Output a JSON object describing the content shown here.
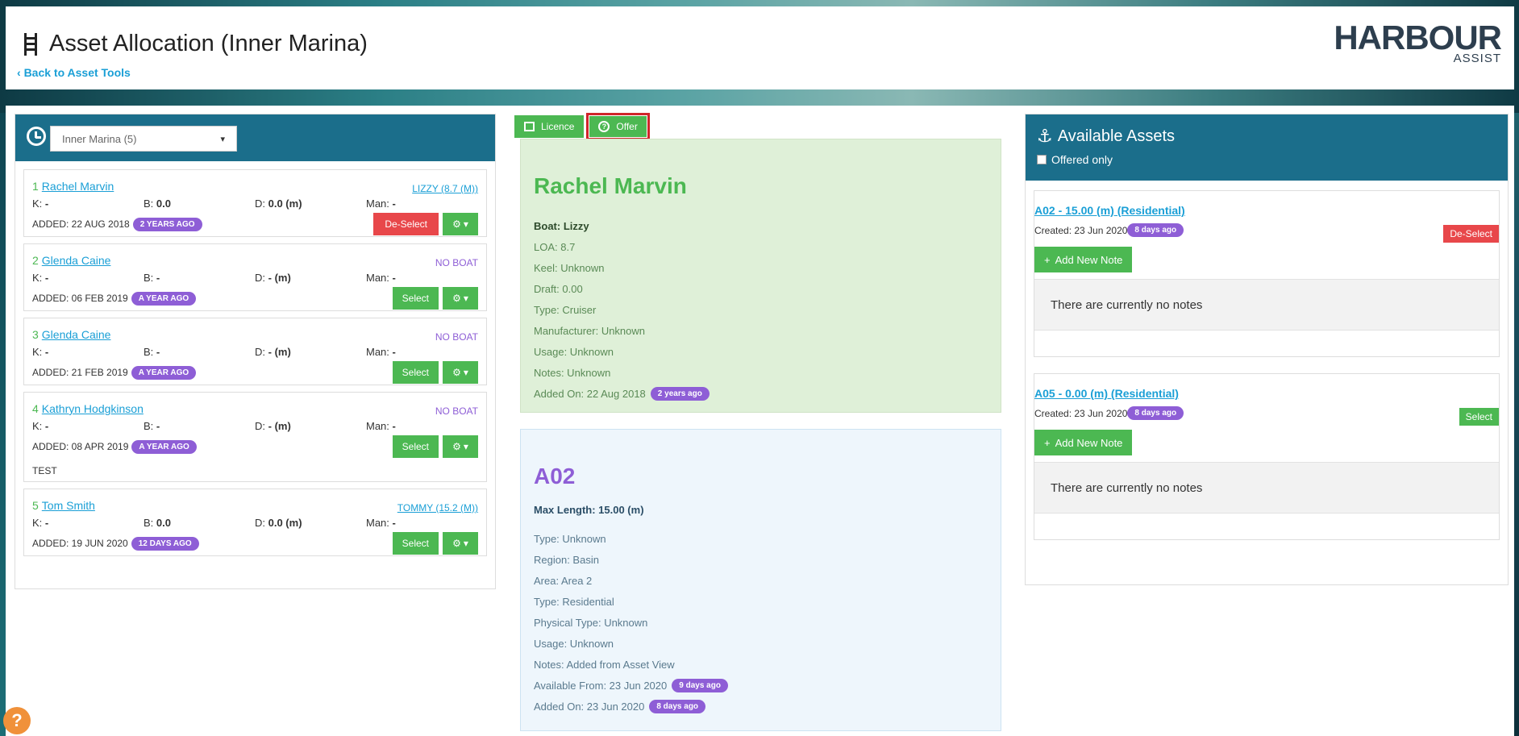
{
  "header": {
    "title": "Asset Allocation (Inner Marina)",
    "back_link": "Back to Asset Tools",
    "logo_main": "HARBOUR",
    "logo_sub": "ASSIST"
  },
  "left": {
    "select_value": "Inner Marina (5)",
    "customers": [
      {
        "num": "1",
        "name": "Rachel Marvin",
        "boat": "LIZZY (8.7 (M))",
        "boat_type": "link",
        "k": "-",
        "b": "0.0",
        "d": "0.0 (m)",
        "man": "-",
        "added": "ADDED: 22 AUG 2018",
        "age": "2 YEARS AGO",
        "action": "De-Select",
        "action_type": "red",
        "note": ""
      },
      {
        "num": "2",
        "name": "Glenda Caine",
        "boat": "NO BOAT",
        "boat_type": "noboat",
        "k": "-",
        "b": "-",
        "d": "- (m)",
        "man": "-",
        "added": "ADDED: 06 FEB 2019",
        "age": "A YEAR AGO",
        "action": "Select",
        "action_type": "green",
        "note": ""
      },
      {
        "num": "3",
        "name": "Glenda Caine",
        "boat": "NO BOAT",
        "boat_type": "noboat",
        "k": "-",
        "b": "-",
        "d": "- (m)",
        "man": "-",
        "added": "ADDED: 21 FEB 2019",
        "age": "A YEAR AGO",
        "action": "Select",
        "action_type": "green",
        "note": ""
      },
      {
        "num": "4",
        "name": "Kathryn Hodgkinson",
        "boat": "NO BOAT",
        "boat_type": "noboat",
        "k": "-",
        "b": "-",
        "d": "- (m)",
        "man": "-",
        "added": "ADDED: 08 APR 2019",
        "age": "A YEAR AGO",
        "action": "Select",
        "action_type": "green",
        "note": "TEST"
      },
      {
        "num": "5",
        "name": "Tom Smith",
        "boat": "TOMMY (15.2 (M))",
        "boat_type": "link",
        "k": "-",
        "b": "0.0",
        "d": "0.0 (m)",
        "man": "-",
        "added": "ADDED: 19 JUN 2020",
        "age": "12 DAYS AGO",
        "action": "Select",
        "action_type": "green",
        "note": ""
      }
    ],
    "labels": {
      "k": "K:",
      "b": "B:",
      "d": "D:",
      "man": "Man:"
    }
  },
  "tabs": {
    "licence": "Licence",
    "offer": "Offer"
  },
  "person": {
    "name": "Rachel Marvin",
    "boat": "Boat: Lizzy",
    "loa": "LOA: 8.7",
    "keel": "Keel: Unknown",
    "draft": "Draft: 0.00",
    "type": "Type: Cruiser",
    "manufacturer": "Manufacturer: Unknown",
    "usage": "Usage: Unknown",
    "notes": "Notes: Unknown",
    "added_on": "Added On: 22 Aug 2018",
    "added_ago": "2 years ago"
  },
  "asset": {
    "code": "A02",
    "max_length": "Max Length: 15.00 (m)",
    "type": "Type: Unknown",
    "region": "Region: Basin",
    "area": "Area: Area 2",
    "type2": "Type: Residential",
    "physical_type": "Physical Type: Unknown",
    "usage": "Usage: Unknown",
    "notes": "Notes: Added from Asset View",
    "available_from": "Available From: 23 Jun 2020",
    "available_ago": "9 days ago",
    "added_on": "Added On: 23 Jun 2020",
    "added_ago": "8 days ago"
  },
  "right": {
    "title": "Available Assets",
    "offered_only": "Offered only",
    "assets": [
      {
        "title": "A02 - 15.00 (m) (Residential)",
        "created": "Created: 23 Jun 2020",
        "ago": "8 days ago",
        "action": "De-Select",
        "action_type": "red",
        "add_note": "Add New Note",
        "empty": "There are currently no notes"
      },
      {
        "title": "A05 - 0.00 (m) (Residential)",
        "created": "Created: 23 Jun 2020",
        "ago": "8 days ago",
        "action": "Select",
        "action_type": "green",
        "add_note": "Add New Note",
        "empty": "There are currently no notes"
      }
    ]
  },
  "help": "?",
  "colors": {
    "green": "#4cb852",
    "red": "#e8474a",
    "purple": "#8e5ed6",
    "teal": "#1b6e8b",
    "link": "#1a9fd6"
  }
}
